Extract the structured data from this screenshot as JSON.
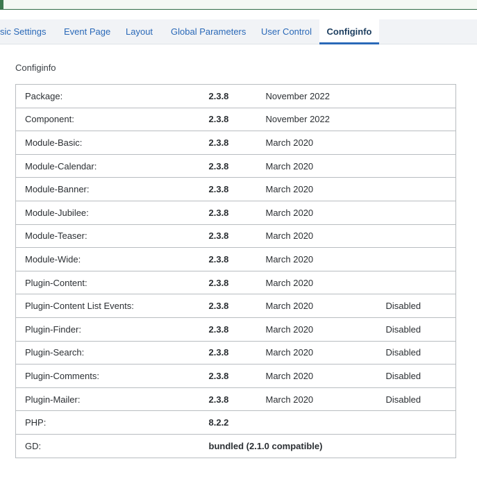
{
  "tabs": [
    {
      "label": "sic Settings"
    },
    {
      "label": "Event Page"
    },
    {
      "label": "Layout"
    },
    {
      "label": "Global Parameters"
    },
    {
      "label": "User Control"
    },
    {
      "label": "Configinfo"
    }
  ],
  "section_title": "Configinfo",
  "rows": [
    {
      "name": "Package:",
      "version": "2.3.8",
      "date": "November 2022",
      "status": ""
    },
    {
      "name": "Component:",
      "version": "2.3.8",
      "date": "November 2022",
      "status": ""
    },
    {
      "name": "Module-Basic:",
      "version": "2.3.8",
      "date": "March 2020",
      "status": ""
    },
    {
      "name": "Module-Calendar:",
      "version": "2.3.8",
      "date": "March 2020",
      "status": ""
    },
    {
      "name": "Module-Banner:",
      "version": "2.3.8",
      "date": "March 2020",
      "status": ""
    },
    {
      "name": "Module-Jubilee:",
      "version": "2.3.8",
      "date": "March 2020",
      "status": ""
    },
    {
      "name": "Module-Teaser:",
      "version": "2.3.8",
      "date": "March 2020",
      "status": ""
    },
    {
      "name": "Module-Wide:",
      "version": "2.3.8",
      "date": "March 2020",
      "status": ""
    },
    {
      "name": "Plugin-Content:",
      "version": "2.3.8",
      "date": "March 2020",
      "status": ""
    },
    {
      "name": "Plugin-Content List Events:",
      "version": "2.3.8",
      "date": "March 2020",
      "status": "Disabled"
    },
    {
      "name": "Plugin-Finder:",
      "version": "2.3.8",
      "date": "March 2020",
      "status": "Disabled"
    },
    {
      "name": "Plugin-Search:",
      "version": "2.3.8",
      "date": "March 2020",
      "status": "Disabled"
    },
    {
      "name": "Plugin-Comments:",
      "version": "2.3.8",
      "date": "March 2020",
      "status": "Disabled"
    },
    {
      "name": "Plugin-Mailer:",
      "version": "2.3.8",
      "date": "March 2020",
      "status": "Disabled"
    },
    {
      "name": "PHP:",
      "version": "8.2.2",
      "date": "",
      "status": ""
    },
    {
      "name": "GD:",
      "version": "bundled (2.1.0 compatible)",
      "date": "",
      "status": ""
    }
  ]
}
